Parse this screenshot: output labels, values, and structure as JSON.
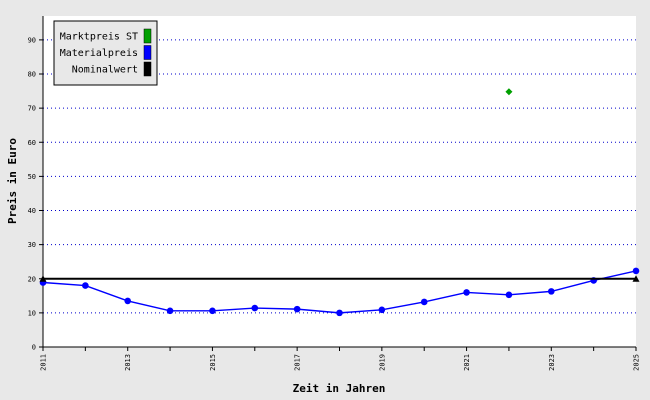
{
  "chart_data": {
    "type": "line",
    "xlabel": "Zeit in Jahren",
    "ylabel": "Preis in Euro",
    "xlim": [
      2011,
      2025
    ],
    "ylim": [
      0,
      97
    ],
    "x_ticks": [
      "2011",
      "2013",
      "2015",
      "2017",
      "2019",
      "2021",
      "2023",
      "2025"
    ],
    "y_ticks": [
      "0",
      "10",
      "20",
      "30",
      "40",
      "50",
      "60",
      "70",
      "80",
      "90"
    ],
    "grid": "horizontal dotted",
    "legend_position": "top-left",
    "series": [
      {
        "name": "Marktpreis ST",
        "color": "#00a000",
        "marker": "diamond",
        "x": [
          2022
        ],
        "y": [
          74.8
        ]
      },
      {
        "name": "Materialpreis",
        "color": "#0000ff",
        "marker": "circle",
        "x": [
          2011,
          2012,
          2013,
          2014,
          2015,
          2016,
          2017,
          2018,
          2019,
          2020,
          2021,
          2022,
          2023,
          2024,
          2025
        ],
        "y": [
          18.9,
          18.0,
          13.5,
          10.6,
          10.6,
          11.4,
          11.1,
          10.0,
          10.9,
          13.2,
          16.0,
          15.3,
          16.3,
          19.5,
          22.3
        ]
      },
      {
        "name": "Nominalwert",
        "color": "#000000",
        "marker": "triangle",
        "x": [
          2011,
          2025
        ],
        "y": [
          20,
          20
        ]
      }
    ]
  }
}
